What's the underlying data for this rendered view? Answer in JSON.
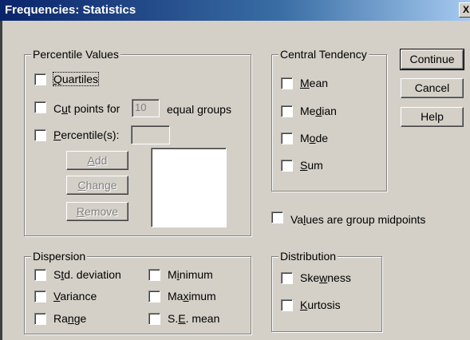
{
  "window": {
    "title": "Frequencies: Statistics",
    "close_glyph": "X"
  },
  "percentile_values": {
    "legend": "Percentile Values",
    "quartiles": {
      "pre": "",
      "key": "Q",
      "post": "uartiles"
    },
    "cut_points": {
      "pre": "C",
      "key": "u",
      "post": "t points for",
      "value": "10",
      "suffix": "equal groups"
    },
    "percentiles": {
      "pre": "",
      "key": "P",
      "post": "ercentile(s):",
      "value": ""
    },
    "buttons": [
      {
        "pre": "",
        "key": "A",
        "post": "dd"
      },
      {
        "pre": "",
        "key": "C",
        "post": "hange"
      },
      {
        "pre": "",
        "key": "R",
        "post": "emove"
      }
    ]
  },
  "central_tendency": {
    "legend": "Central Tendency",
    "items": [
      {
        "pre": "",
        "key": "M",
        "post": "ean"
      },
      {
        "pre": "Me",
        "key": "d",
        "post": "ian"
      },
      {
        "pre": "M",
        "key": "o",
        "post": "de"
      },
      {
        "pre": "",
        "key": "S",
        "post": "um"
      }
    ]
  },
  "actions": {
    "continue": "Continue",
    "cancel": "Cancel",
    "help": "Help"
  },
  "group_midpoints": {
    "pre": "Va",
    "key": "l",
    "post": "ues are group midpoints"
  },
  "dispersion": {
    "legend": "Dispersion",
    "std_deviation": {
      "pre": "S",
      "key": "t",
      "post": "d. deviation"
    },
    "minimum": {
      "pre": "M",
      "key": "i",
      "post": "nimum"
    },
    "variance": {
      "pre": "",
      "key": "V",
      "post": "ariance"
    },
    "maximum": {
      "pre": "Ma",
      "key": "x",
      "post": "imum"
    },
    "range": {
      "pre": "Ra",
      "key": "n",
      "post": "ge"
    },
    "se_mean": {
      "pre": "S.",
      "key": "E",
      "post": ". mean"
    }
  },
  "distribution": {
    "legend": "Distribution",
    "skewness": {
      "pre": "Ske",
      "key": "w",
      "post": "ness"
    },
    "kurtosis": {
      "pre": "",
      "key": "K",
      "post": "urtosis"
    }
  }
}
